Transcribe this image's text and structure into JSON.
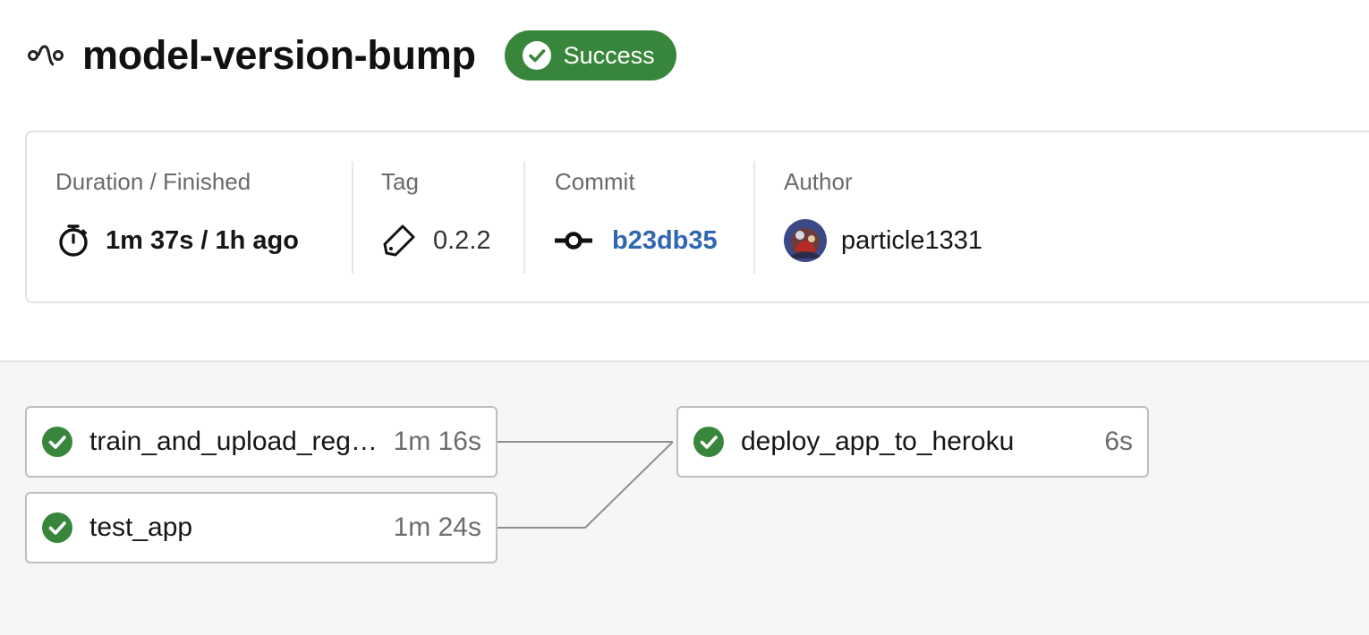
{
  "header": {
    "workflow_icon": "workflow-icon",
    "title": "model-version-bump",
    "status": "Success",
    "status_icon": "check-circle-icon",
    "status_color": "#37863b"
  },
  "info": {
    "duration": {
      "label": "Duration / Finished",
      "value": "1m 37s / 1h ago",
      "icon": "stopwatch-icon"
    },
    "tag": {
      "label": "Tag",
      "value": "0.2.2",
      "icon": "tag-icon"
    },
    "commit": {
      "label": "Commit",
      "value": "b23db35",
      "icon": "commit-icon",
      "link_color": "#2f67b1"
    },
    "author": {
      "label": "Author",
      "value": "particle1331",
      "icon": "avatar"
    }
  },
  "jobs": [
    {
      "name": "train_and_upload_reg…",
      "duration": "1m 16s",
      "status_icon": "check-circle-icon"
    },
    {
      "name": "test_app",
      "duration": "1m 24s",
      "status_icon": "check-circle-icon"
    },
    {
      "name": "deploy_app_to_heroku",
      "duration": "6s",
      "status_icon": "check-circle-icon"
    }
  ]
}
